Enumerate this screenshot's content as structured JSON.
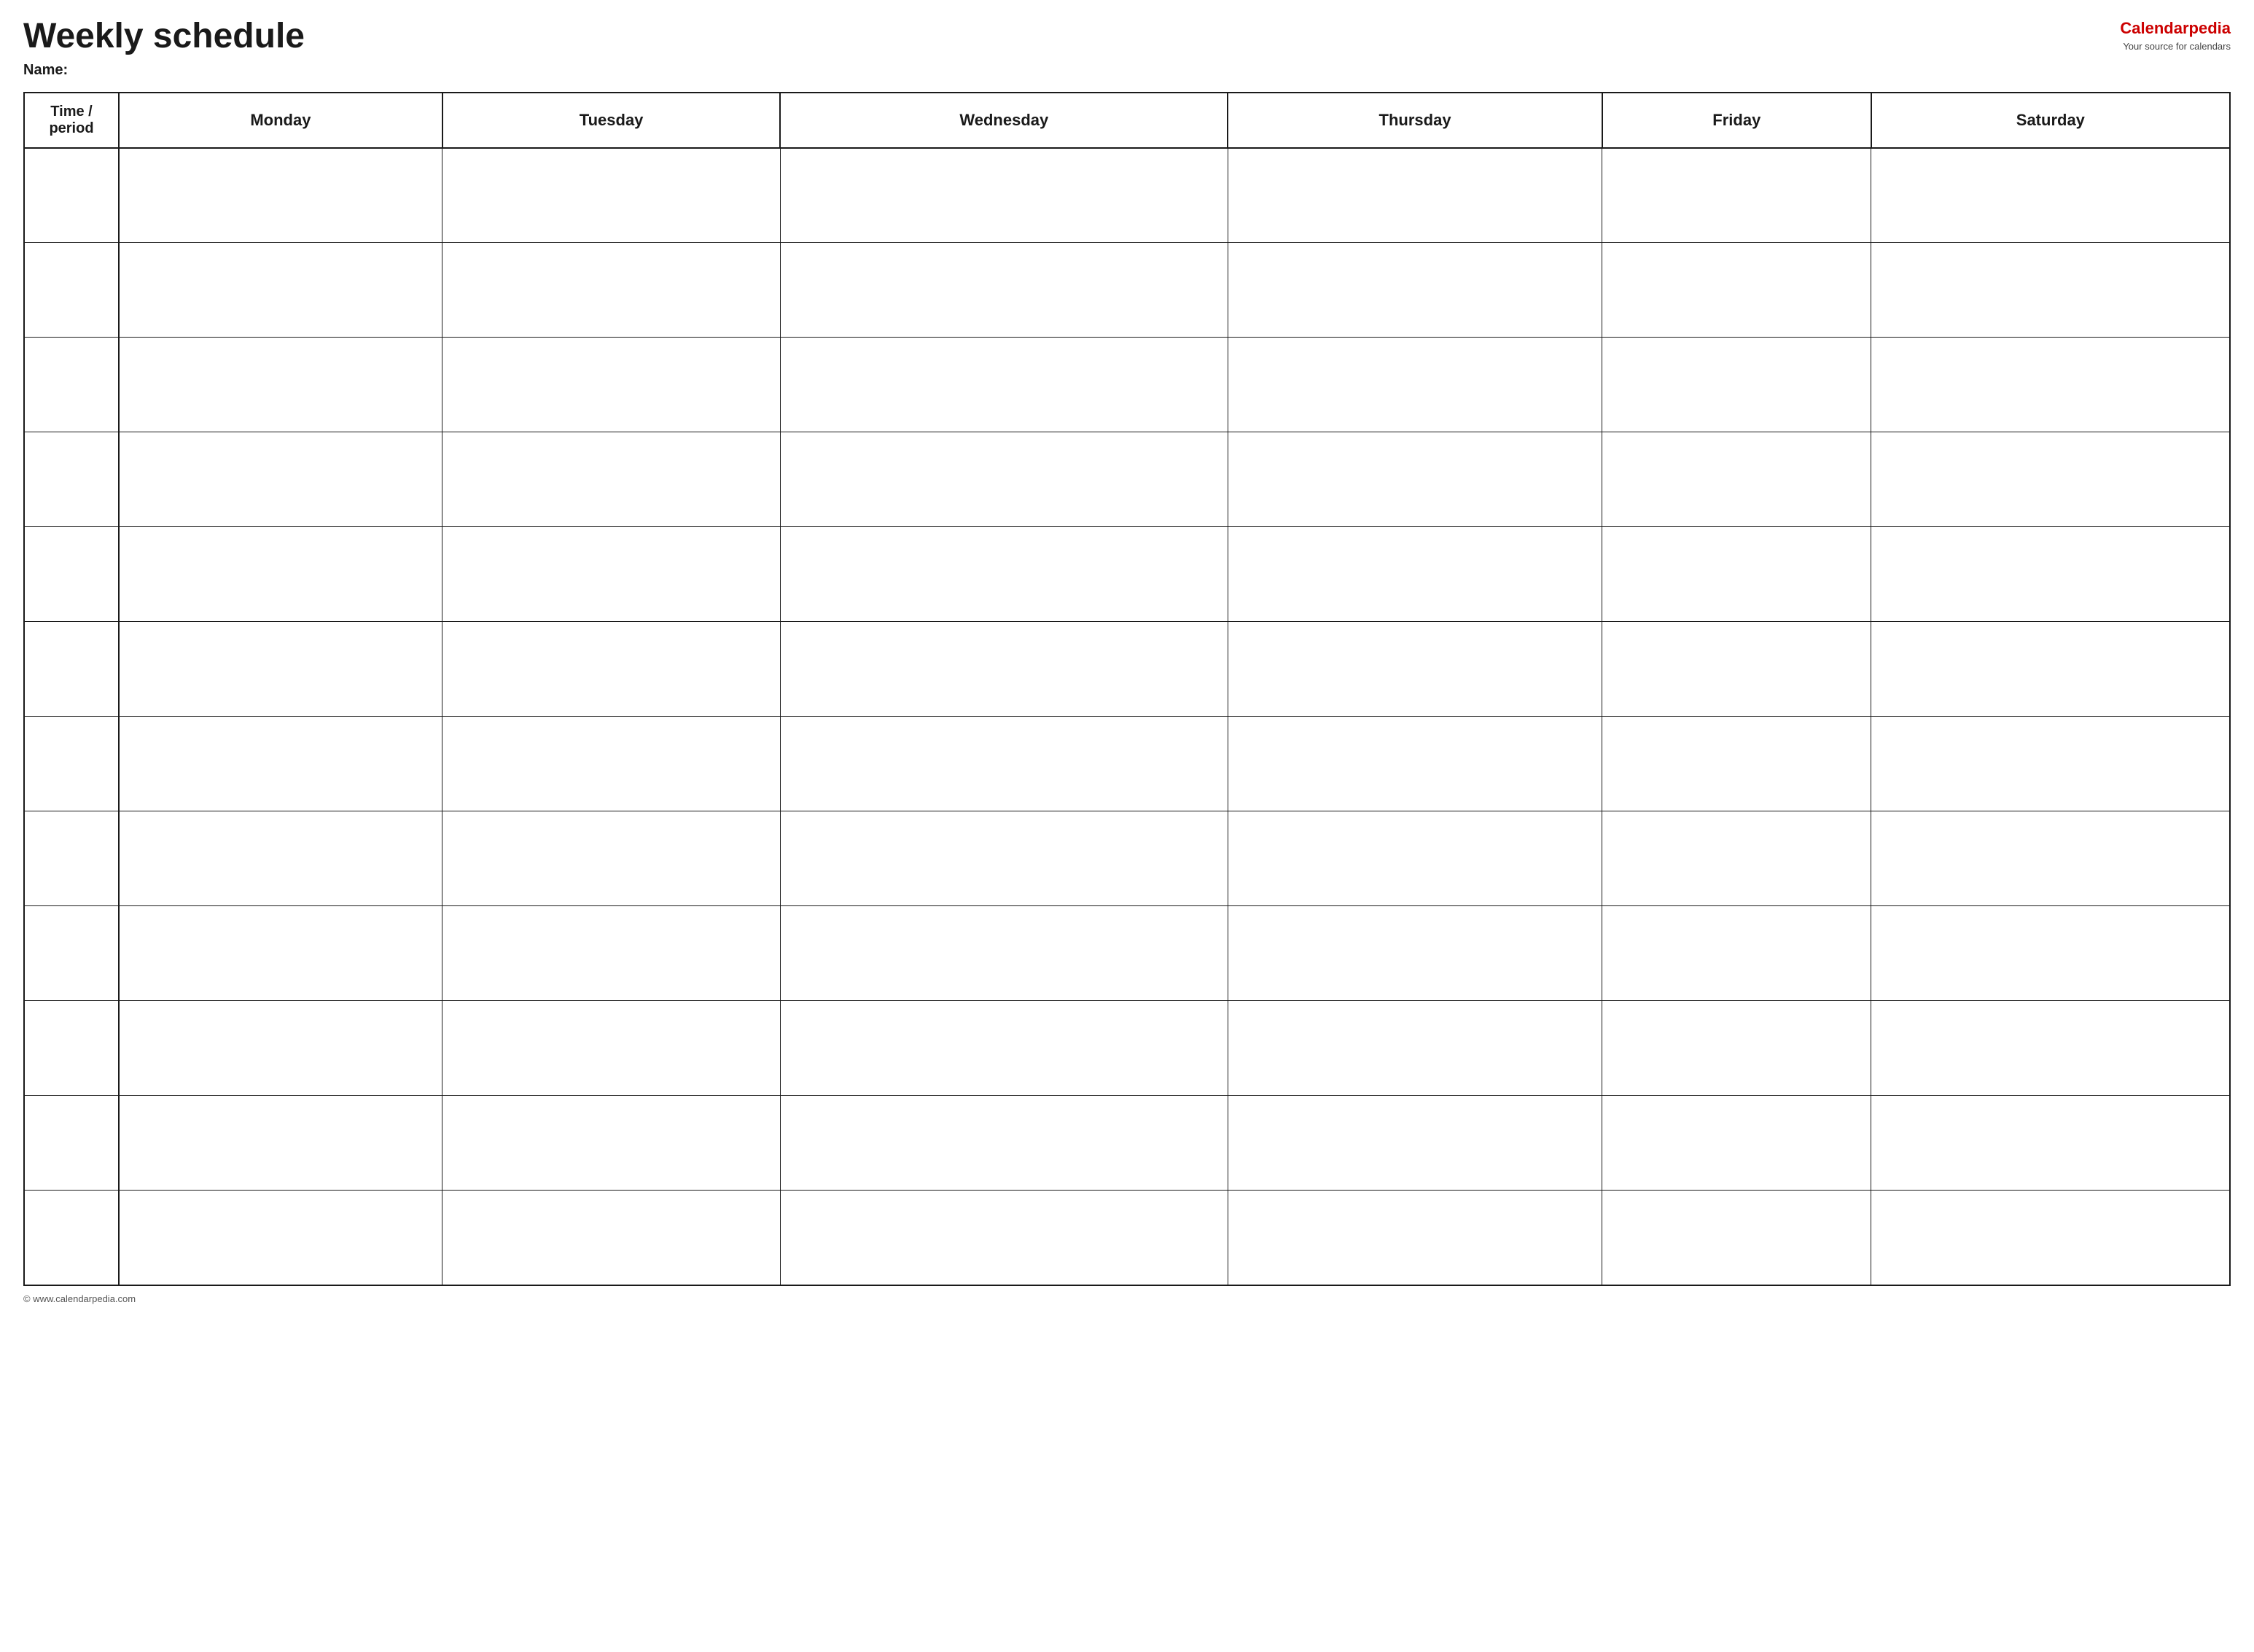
{
  "header": {
    "title": "Weekly schedule",
    "name_label": "Name:",
    "logo_calendar": "Calendar",
    "logo_pedia": "pedia",
    "logo_subtitle": "Your source for calendars"
  },
  "table": {
    "columns": [
      {
        "id": "time",
        "label": "Time / period"
      },
      {
        "id": "monday",
        "label": "Monday"
      },
      {
        "id": "tuesday",
        "label": "Tuesday"
      },
      {
        "id": "wednesday",
        "label": "Wednesday"
      },
      {
        "id": "thursday",
        "label": "Thursday"
      },
      {
        "id": "friday",
        "label": "Friday"
      },
      {
        "id": "saturday",
        "label": "Saturday"
      }
    ],
    "rows": 12
  },
  "footer": {
    "url": "© www.calendarpedia.com"
  }
}
